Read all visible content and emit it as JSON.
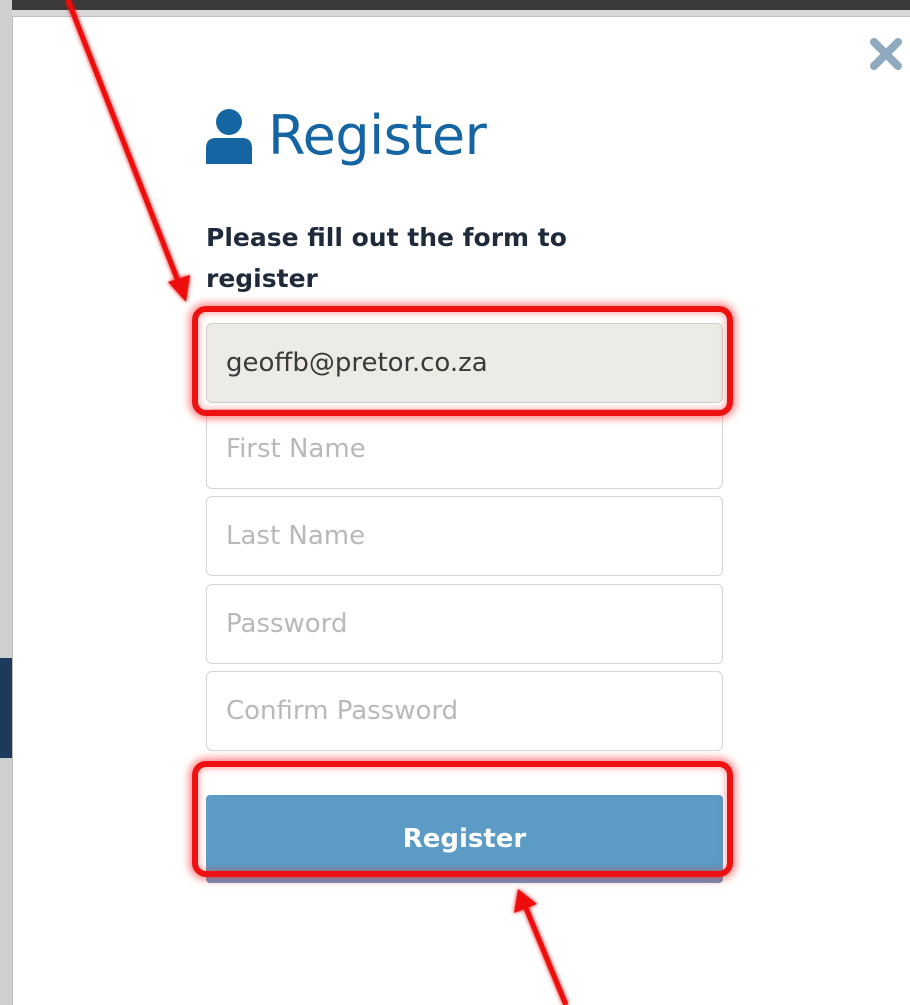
{
  "dialog": {
    "title": "Register",
    "subtitle": "Please fill out the form to register",
    "close_icon": "close-icon",
    "title_icon": "user-icon"
  },
  "form": {
    "email_value": "geoffb@pretor.co.za",
    "first_name_placeholder": "First Name",
    "last_name_placeholder": "Last Name",
    "password_placeholder": "Password",
    "confirm_password_placeholder": "Confirm Password",
    "submit_label": "Register"
  },
  "colors": {
    "title": "#1565a3",
    "button": "#5b9bc5",
    "annotation": "#ee1111"
  }
}
